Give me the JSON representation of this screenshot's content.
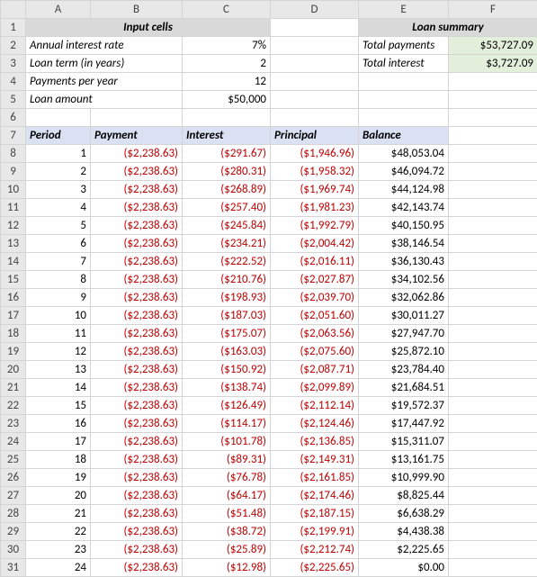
{
  "colHeaders": [
    "A",
    "B",
    "C",
    "D",
    "E",
    "F"
  ],
  "sectionHeaders": {
    "input": "Input cells",
    "summary": "Loan summary"
  },
  "inputs": {
    "rateLabel": "Annual interest rate",
    "rateVal": "7%",
    "termLabel": "Loan term (in years)",
    "termVal": "2",
    "ppyLabel": "Payments per year",
    "ppyVal": "12",
    "amtLabel": "Loan amount",
    "amtVal": "$50,000"
  },
  "summary": {
    "totalPaymentsLabel": "Total payments",
    "totalPaymentsVal": "$53,727.09",
    "totalInterestLabel": "Total interest",
    "totalInterestVal": "$3,727.09"
  },
  "tableHeaders": {
    "period": "Period",
    "payment": "Payment",
    "interest": "Interest",
    "principal": "Principal",
    "balance": "Balance"
  },
  "rows": [
    {
      "r": "8",
      "p": "1",
      "pay": "($2,238.63)",
      "int": "($291.67)",
      "prin": "($1,946.96)",
      "bal": "$48,053.04"
    },
    {
      "r": "9",
      "p": "2",
      "pay": "($2,238.63)",
      "int": "($280.31)",
      "prin": "($1,958.32)",
      "bal": "$46,094.72"
    },
    {
      "r": "10",
      "p": "3",
      "pay": "($2,238.63)",
      "int": "($268.89)",
      "prin": "($1,969.74)",
      "bal": "$44,124.98"
    },
    {
      "r": "11",
      "p": "4",
      "pay": "($2,238.63)",
      "int": "($257.40)",
      "prin": "($1,981.23)",
      "bal": "$42,143.74"
    },
    {
      "r": "12",
      "p": "5",
      "pay": "($2,238.63)",
      "int": "($245.84)",
      "prin": "($1,992.79)",
      "bal": "$40,150.95"
    },
    {
      "r": "13",
      "p": "6",
      "pay": "($2,238.63)",
      "int": "($234.21)",
      "prin": "($2,004.42)",
      "bal": "$38,146.54"
    },
    {
      "r": "14",
      "p": "7",
      "pay": "($2,238.63)",
      "int": "($222.52)",
      "prin": "($2,016.11)",
      "bal": "$36,130.43"
    },
    {
      "r": "15",
      "p": "8",
      "pay": "($2,238.63)",
      "int": "($210.76)",
      "prin": "($2,027.87)",
      "bal": "$34,102.56"
    },
    {
      "r": "16",
      "p": "9",
      "pay": "($2,238.63)",
      "int": "($198.93)",
      "prin": "($2,039.70)",
      "bal": "$32,062.86"
    },
    {
      "r": "17",
      "p": "10",
      "pay": "($2,238.63)",
      "int": "($187.03)",
      "prin": "($2,051.60)",
      "bal": "$30,011.27"
    },
    {
      "r": "18",
      "p": "11",
      "pay": "($2,238.63)",
      "int": "($175.07)",
      "prin": "($2,063.56)",
      "bal": "$27,947.70"
    },
    {
      "r": "19",
      "p": "12",
      "pay": "($2,238.63)",
      "int": "($163.03)",
      "prin": "($2,075.60)",
      "bal": "$25,872.10"
    },
    {
      "r": "20",
      "p": "13",
      "pay": "($2,238.63)",
      "int": "($150.92)",
      "prin": "($2,087.71)",
      "bal": "$23,784.40"
    },
    {
      "r": "21",
      "p": "14",
      "pay": "($2,238.63)",
      "int": "($138.74)",
      "prin": "($2,099.89)",
      "bal": "$21,684.51"
    },
    {
      "r": "22",
      "p": "15",
      "pay": "($2,238.63)",
      "int": "($126.49)",
      "prin": "($2,112.14)",
      "bal": "$19,572.37"
    },
    {
      "r": "23",
      "p": "16",
      "pay": "($2,238.63)",
      "int": "($114.17)",
      "prin": "($2,124.46)",
      "bal": "$17,447.92"
    },
    {
      "r": "24",
      "p": "17",
      "pay": "($2,238.63)",
      "int": "($101.78)",
      "prin": "($2,136.85)",
      "bal": "$15,311.07"
    },
    {
      "r": "25",
      "p": "18",
      "pay": "($2,238.63)",
      "int": "($89.31)",
      "prin": "($2,149.31)",
      "bal": "$13,161.75"
    },
    {
      "r": "26",
      "p": "19",
      "pay": "($2,238.63)",
      "int": "($76.78)",
      "prin": "($2,161.85)",
      "bal": "$10,999.90"
    },
    {
      "r": "27",
      "p": "20",
      "pay": "($2,238.63)",
      "int": "($64.17)",
      "prin": "($2,174.46)",
      "bal": "$8,825.44"
    },
    {
      "r": "28",
      "p": "21",
      "pay": "($2,238.63)",
      "int": "($51.48)",
      "prin": "($2,187.15)",
      "bal": "$6,638.29"
    },
    {
      "r": "29",
      "p": "22",
      "pay": "($2,238.63)",
      "int": "($38.72)",
      "prin": "($2,199.91)",
      "bal": "$4,438.38"
    },
    {
      "r": "30",
      "p": "23",
      "pay": "($2,238.63)",
      "int": "($25.89)",
      "prin": "($2,212.74)",
      "bal": "$2,225.65"
    },
    {
      "r": "31",
      "p": "24",
      "pay": "($2,238.63)",
      "int": "($12.98)",
      "prin": "($2,225.65)",
      "bal": "$0.00"
    }
  ],
  "chart_data": {
    "type": "table",
    "title": "Loan amortization schedule",
    "columns": [
      "Period",
      "Payment",
      "Interest",
      "Principal",
      "Balance"
    ],
    "data": [
      [
        1,
        -2238.63,
        -291.67,
        -1946.96,
        48053.04
      ],
      [
        2,
        -2238.63,
        -280.31,
        -1958.32,
        46094.72
      ],
      [
        3,
        -2238.63,
        -268.89,
        -1969.74,
        44124.98
      ],
      [
        4,
        -2238.63,
        -257.4,
        -1981.23,
        42143.74
      ],
      [
        5,
        -2238.63,
        -245.84,
        -1992.79,
        40150.95
      ],
      [
        6,
        -2238.63,
        -234.21,
        -2004.42,
        38146.54
      ],
      [
        7,
        -2238.63,
        -222.52,
        -2016.11,
        36130.43
      ],
      [
        8,
        -2238.63,
        -210.76,
        -2027.87,
        34102.56
      ],
      [
        9,
        -2238.63,
        -198.93,
        -2039.7,
        32062.86
      ],
      [
        10,
        -2238.63,
        -187.03,
        -2051.6,
        30011.27
      ],
      [
        11,
        -2238.63,
        -175.07,
        -2063.56,
        27947.7
      ],
      [
        12,
        -2238.63,
        -163.03,
        -2075.6,
        25872.1
      ],
      [
        13,
        -2238.63,
        -150.92,
        -2087.71,
        23784.4
      ],
      [
        14,
        -2238.63,
        -138.74,
        -2099.89,
        21684.51
      ],
      [
        15,
        -2238.63,
        -126.49,
        -2112.14,
        19572.37
      ],
      [
        16,
        -2238.63,
        -114.17,
        -2124.46,
        17447.92
      ],
      [
        17,
        -2238.63,
        -101.78,
        -2136.85,
        15311.07
      ],
      [
        18,
        -2238.63,
        -89.31,
        -2149.31,
        13161.75
      ],
      [
        19,
        -2238.63,
        -76.78,
        -2161.85,
        10999.9
      ],
      [
        20,
        -2238.63,
        -64.17,
        -2174.46,
        8825.44
      ],
      [
        21,
        -2238.63,
        -51.48,
        -2187.15,
        6638.29
      ],
      [
        22,
        -2238.63,
        -38.72,
        -2199.91,
        4438.38
      ],
      [
        23,
        -2238.63,
        -25.89,
        -2212.74,
        2225.65
      ],
      [
        24,
        -2238.63,
        -12.98,
        -2225.65,
        0.0
      ]
    ]
  }
}
